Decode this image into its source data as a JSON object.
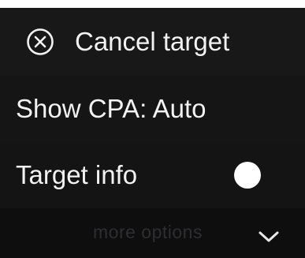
{
  "menu": {
    "cancel_target": {
      "label": "Cancel target",
      "icon": "close-circle-icon"
    },
    "show_cpa": {
      "label": "Show CPA: Auto"
    },
    "target_info": {
      "label": "Target info",
      "toggle_icon": "toggle-knob-icon"
    },
    "more_options": {
      "label": "more options",
      "icon": "chevron-down-icon"
    }
  },
  "colors": {
    "background": "#121213",
    "text": "#f2f2f2",
    "muted_text": "#2e2e31",
    "accent": "#ffffff"
  }
}
